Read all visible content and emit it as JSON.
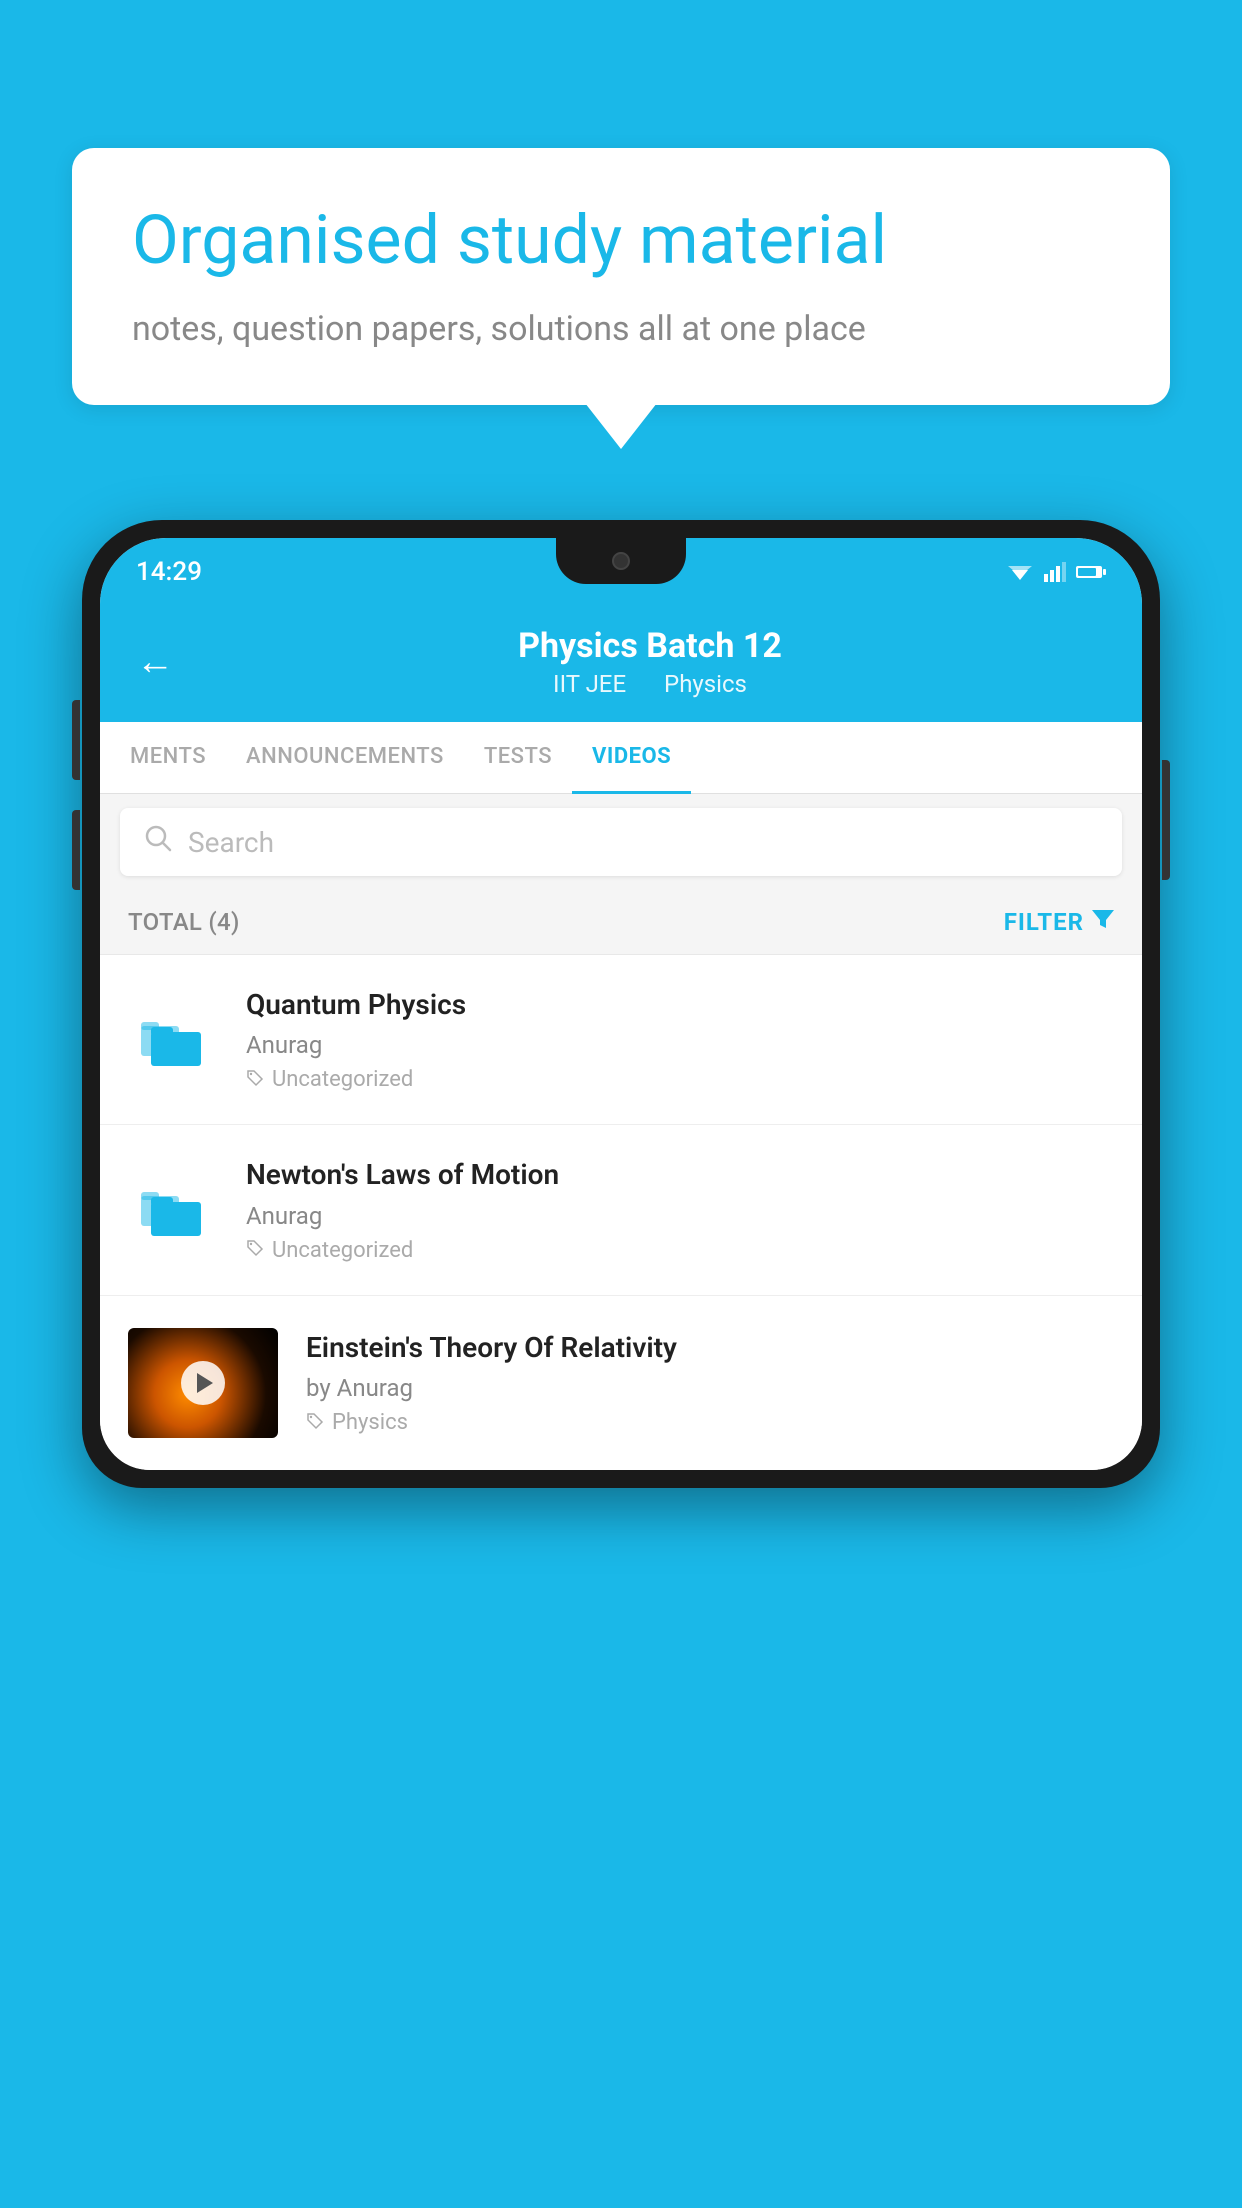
{
  "background_color": "#1ab8e8",
  "speech_bubble": {
    "title": "Organised study material",
    "subtitle": "notes, question papers, solutions all at one place"
  },
  "phone": {
    "status_bar": {
      "time": "14:29"
    },
    "app_header": {
      "title": "Physics Batch 12",
      "subtitle_part1": "IIT JEE",
      "subtitle_part2": "Physics",
      "back_icon": "←"
    },
    "tabs": [
      {
        "label": "MENTS",
        "active": false
      },
      {
        "label": "ANNOUNCEMENTS",
        "active": false
      },
      {
        "label": "TESTS",
        "active": false
      },
      {
        "label": "VIDEOS",
        "active": true
      }
    ],
    "search": {
      "placeholder": "Search"
    },
    "filter_bar": {
      "total_label": "TOTAL (4)",
      "filter_label": "FILTER"
    },
    "video_list": [
      {
        "id": 1,
        "type": "folder",
        "title": "Quantum Physics",
        "author": "Anurag",
        "tag": "Uncategorized"
      },
      {
        "id": 2,
        "type": "folder",
        "title": "Newton's Laws of Motion",
        "author": "Anurag",
        "tag": "Uncategorized"
      },
      {
        "id": 3,
        "type": "video",
        "title": "Einstein's Theory Of Relativity",
        "author": "by Anurag",
        "tag": "Physics"
      }
    ]
  }
}
